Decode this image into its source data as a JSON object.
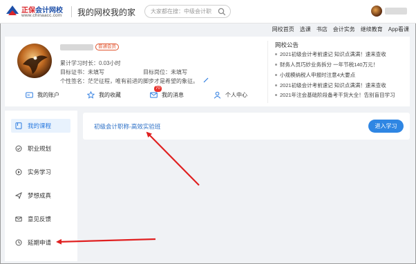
{
  "header": {
    "logo_name_red": "正保",
    "logo_name_blue": "会计网校",
    "logo_url": "www.chinaacc.com",
    "title": "我的网校我的家",
    "search_placeholder": "大家都在搜：中级会计职",
    "search_icon": "search-icon"
  },
  "topnav": [
    "网校首页",
    "选课",
    "书店",
    "会计实务",
    "继续教育",
    "App看课"
  ],
  "profile": {
    "member_badge": "普通会员",
    "study_time": "累计学习时长：0.03小时",
    "target_cert": "目标证书：未填写",
    "target_post": "目标岗位：未填写",
    "signature": "个性签名：茫茫征程，唯有前进的脚步才是希望的象征。",
    "quick_links": [
      {
        "label": "我的账户",
        "icon": "account-card-icon"
      },
      {
        "label": "我的收藏",
        "icon": "star-icon"
      },
      {
        "label": "我的消息",
        "icon": "mail-icon",
        "badge": "70"
      },
      {
        "label": "个人中心",
        "icon": "user-icon"
      }
    ]
  },
  "notices": {
    "title": "网校公告",
    "items": [
      "2021初级会计考前速记 知识点满满！速来查收",
      "财务人员巧妙业务拆分 一年节税140万元！",
      "小规模纳税人申报时注意4大要点",
      "2021初级会计考前速记 知识点满满！速来查收",
      "2021年注会基础阶段备考干货大全！告别盲目学习"
    ]
  },
  "sidebar": {
    "items": [
      {
        "label": "我的课程",
        "icon": "course-icon",
        "active": true
      },
      {
        "label": "职业规划",
        "icon": "career-icon"
      },
      {
        "label": "实务学习",
        "icon": "practice-icon"
      },
      {
        "label": "梦想成真",
        "icon": "dream-icon"
      },
      {
        "label": "意见反馈",
        "icon": "feedback-icon"
      },
      {
        "label": "延期申请",
        "icon": "delay-icon"
      }
    ]
  },
  "course": {
    "title": "初级会计职称-高效实验班",
    "button": "进入学习"
  },
  "colors": {
    "accent": "#2f86e3",
    "link": "#2b6fc6",
    "badge_red": "#e8312b",
    "arrow_red": "#e02020"
  }
}
